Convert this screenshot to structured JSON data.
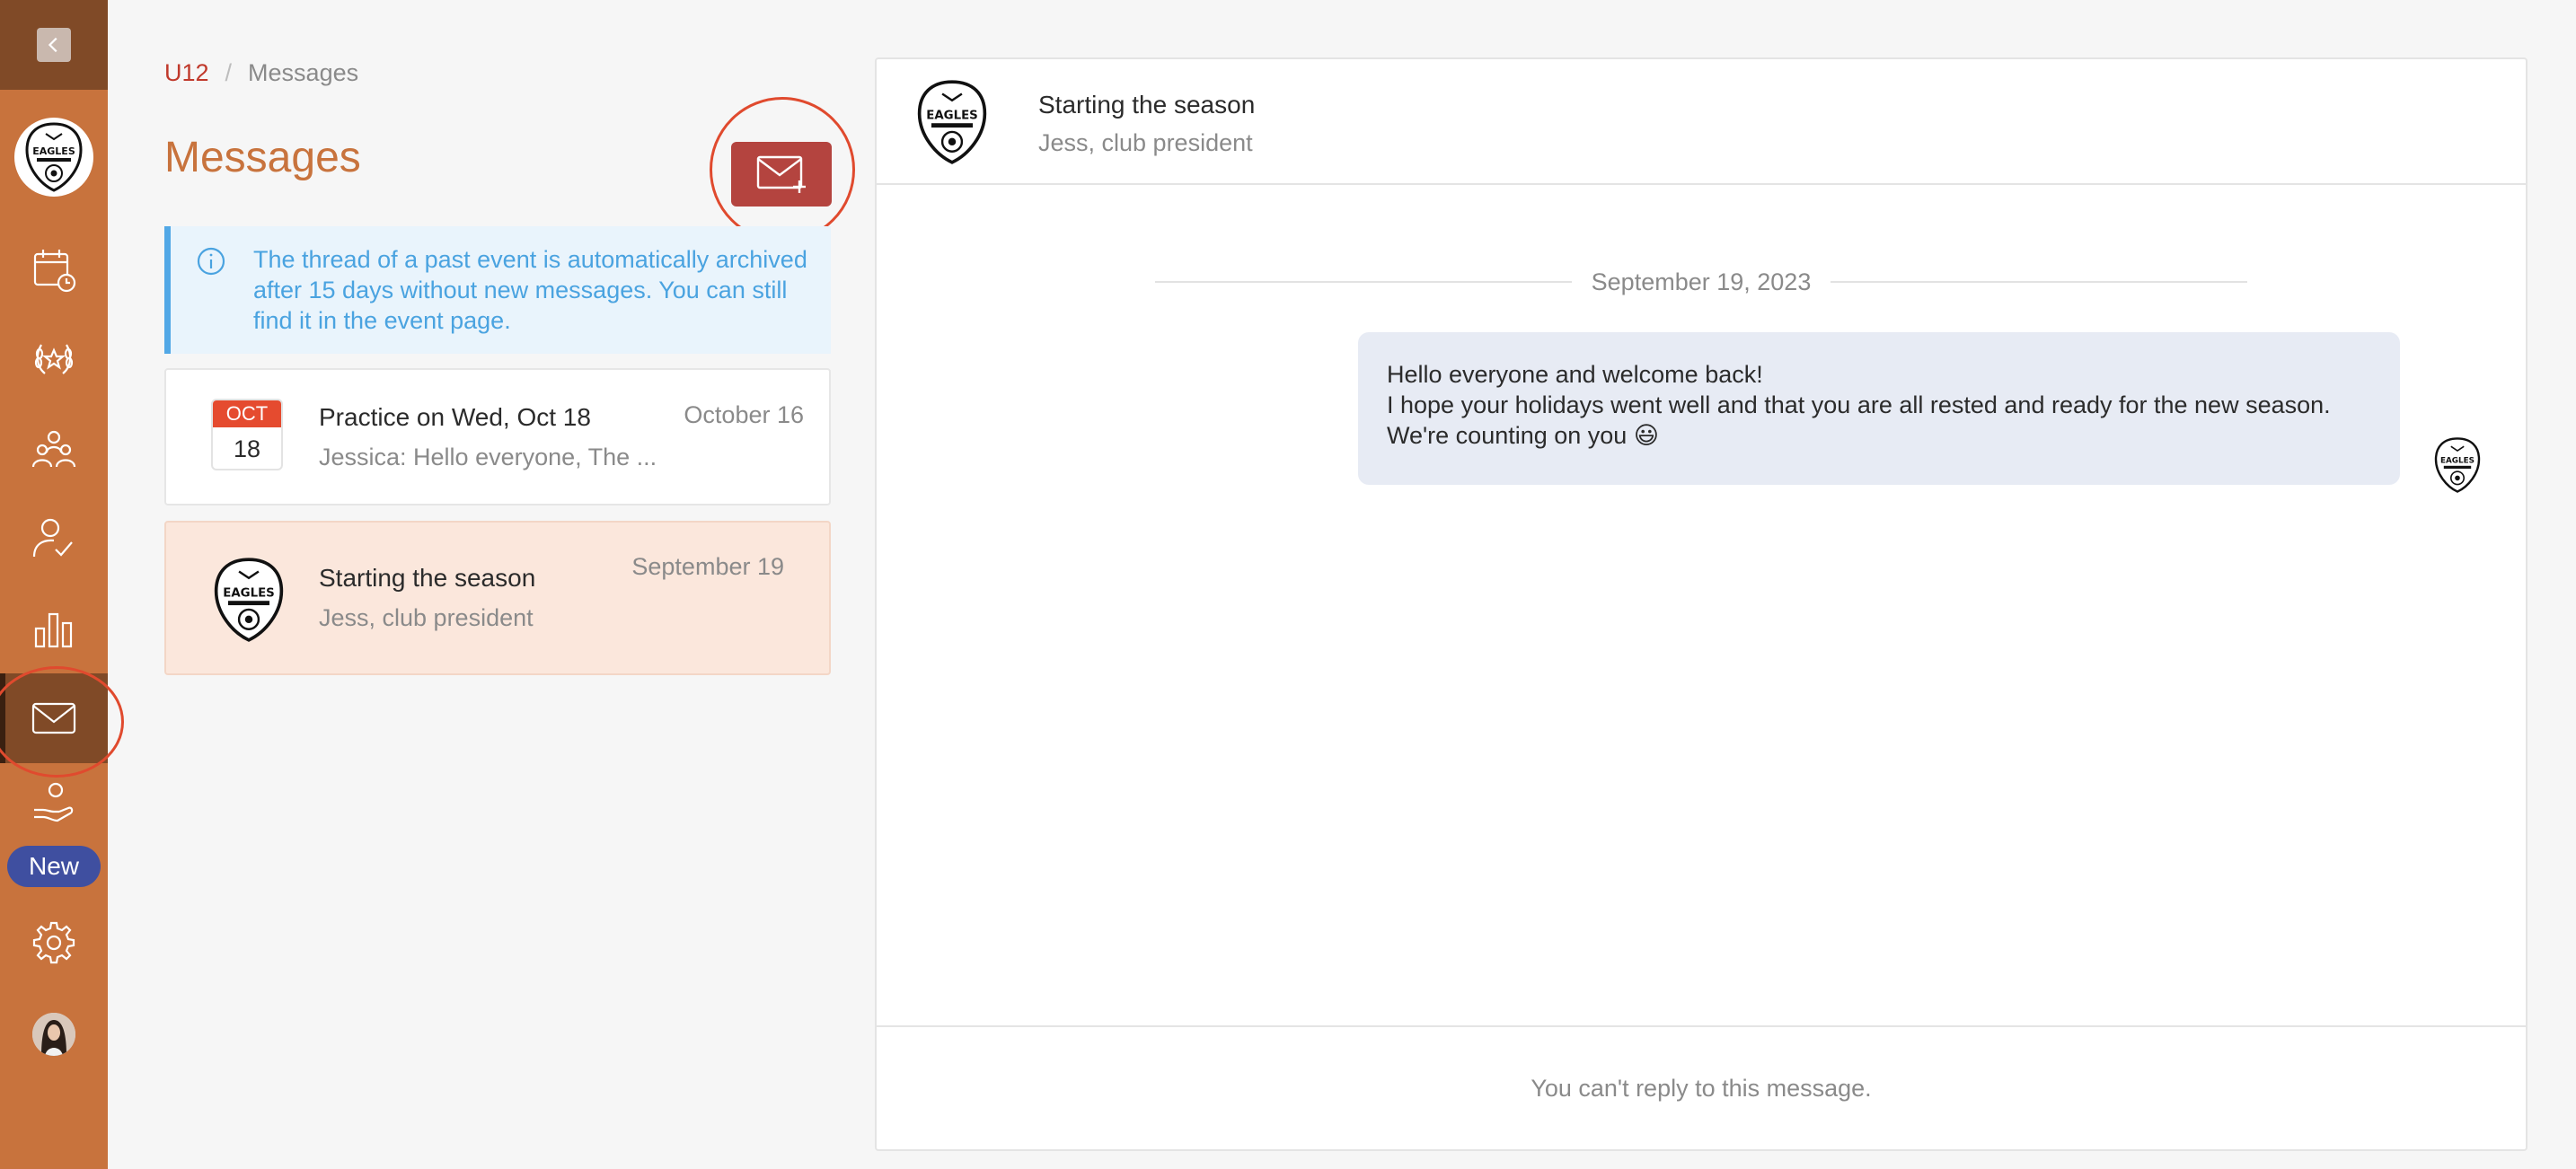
{
  "breadcrumb": {
    "team": "U12",
    "separator": "/",
    "current": "Messages"
  },
  "page": {
    "title": "Messages"
  },
  "info_banner": {
    "text": "The thread of a past event is automatically archived after 15 days without new messages. You can still find it in the event page."
  },
  "threads": [
    {
      "title": "Practice on Wed, Oct 18",
      "preview": "Jessica: Hello everyone, The ...",
      "date": "October 16",
      "calendar": {
        "month": "OCT",
        "day": "18"
      }
    },
    {
      "title": "Starting the season",
      "preview": "Jess, club president",
      "date": "September 19",
      "logo_text": "EAGLES"
    }
  ],
  "conversation": {
    "title": "Starting the season",
    "subtitle": "Jess, club president",
    "date_separator": "September 19, 2023",
    "message_lines": [
      "Hello everyone and welcome back!",
      "I hope your holidays went well and that you are all rested and ready for the new season.",
      "We're counting on you 😃"
    ],
    "footer": "You can't reply to this message."
  },
  "sidebar": {
    "new_badge": "New",
    "logo_text": "EAGLES",
    "items": [
      "calendar-icon",
      "trophy-icon",
      "team-icon",
      "attendance-icon",
      "stats-icon",
      "mail-icon",
      "donation-icon",
      "gear-icon"
    ]
  },
  "colors": {
    "sidebar": "#c8733d",
    "sidebar_dark": "#804a27",
    "accent_title": "#c8733d",
    "compose_button": "#b4443f",
    "info_text": "#4aa3e0",
    "highlight_ring": "#e04a2e",
    "new_badge": "#3f4fa0"
  }
}
